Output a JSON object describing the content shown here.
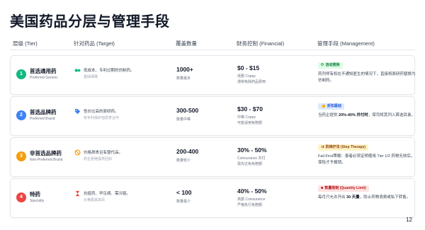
{
  "title": "美国药品分层与管理手段",
  "headers": {
    "tier": "层级 (Tier)",
    "target": "针对药品 (Target)",
    "coverage": "覆盖数量",
    "financial": "财务控制 (Financial)",
    "management": "管理手段 (Management)"
  },
  "rows": [
    {
      "num": "1",
      "num_color": "#10b981",
      "tier_name": "首选通用药",
      "tier_sub": "Preferred Generic",
      "target_icon": "pills-icon",
      "target_icon_color": "#10b981",
      "target_main": "低成本、专利过期的仿制药。",
      "target_sub": "基础保障",
      "coverage_main": "1000+",
      "coverage_sub": "数量最多",
      "financial_main": "$0 - $15",
      "financial_sub": "低额 Copay",
      "financial_sub2": "通常免除药品费用",
      "badge_label": "自动替换",
      "badge_icon": "refresh-icon",
      "badge_bg": "#dcfce7",
      "badge_fg": "#15803d",
      "mgmt_pre": "药剂师有权在不通知医生的情况下，直接将原研药替换为仿制药。",
      "mgmt_bold": "",
      "mgmt_post": ""
    },
    {
      "num": "2",
      "num_color": "#3b82f6",
      "tier_name": "首选品牌药",
      "tier_sub": "Preferred Brand",
      "target_icon": "tag-icon",
      "target_icon_color": "#3b82f6",
      "target_main": "性价比高的原研药。",
      "target_sub": "有专利保护但愿意合作",
      "coverage_main": "300-500",
      "coverage_sub": "数量中等",
      "financial_main": "$30 - $70",
      "financial_sub": "中等 Copay",
      "financial_sub2": "可能适用免赔额",
      "badge_label": "折扣驱动",
      "badge_icon": "thumbs-up-icon",
      "badge_bg": "#dbeafe",
      "badge_fg": "#1d4ed8",
      "mgmt_pre": "当药企提供 ",
      "mgmt_bold": "20%-40% 并付时",
      "mgmt_post": "，保司将其列入首选目录。"
    },
    {
      "num": "3",
      "num_color": "#f59e0b",
      "tier_name": "非首选品牌药",
      "tier_sub": "Non-Preferred Brand",
      "target_icon": "ban-icon",
      "target_icon_color": "#f59e0b",
      "target_main": "价格昂贵且有替代品。",
      "target_sub": "药企拒绝提供回扣",
      "coverage_main": "200-400",
      "coverage_sub": "数量较少",
      "financial_main": "30% - 50%",
      "financial_sub": "Coinsurance 共付",
      "financial_sub2": "需先达免免赔额",
      "badge_label": "阶梯疗法 (Step Therapy)",
      "badge_icon": "steps-icon",
      "badge_bg": "#fef3c7",
      "badge_fg": "#92400e",
      "mgmt_pre": "Fail-First策略：患者必须证明使用 Tier 1/2 药物无效后，保险才予报销。",
      "mgmt_bold": "",
      "mgmt_post": ""
    },
    {
      "num": "4",
      "num_color": "#ef4444",
      "tier_name": "特药",
      "tier_sub": "Specialty",
      "target_icon": "hourglass-icon",
      "target_icon_color": "#ef4444",
      "target_main": "抗癌药、罕见病、需冷链。",
      "target_sub": "价格极其高昂",
      "coverage_main": "< 100",
      "coverage_sub": "数量极少",
      "financial_main": "40% - 50%",
      "financial_sub": "高额 Coinsurance",
      "financial_sub2": "严格执行免赔额",
      "badge_label": "数量限制 (Quantity Limit)",
      "badge_icon": "limit-icon",
      "badge_bg": "#fee2e2",
      "badge_fg": "#b91c1c",
      "mgmt_pre": "每月只允许开出 ",
      "mgmt_bold": "30 天量",
      "mgmt_post": "，防止药物浪费或私下转售。"
    }
  ],
  "page_number": "12"
}
